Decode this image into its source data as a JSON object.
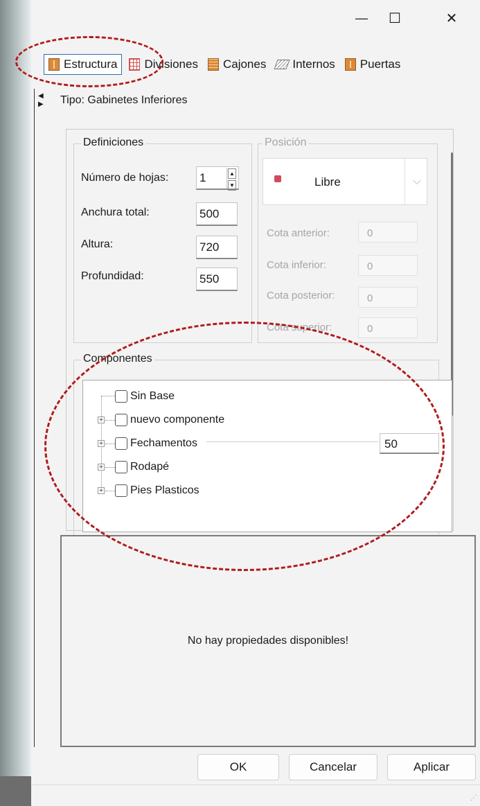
{
  "window": {
    "controls": {
      "minimize": "—",
      "maximize": "☐",
      "close": "✕"
    }
  },
  "tabs": [
    {
      "label": "Estructura",
      "icon": "estructura-icon",
      "active": true
    },
    {
      "label": "Divisiones",
      "icon": "divisiones-grid-icon",
      "active": false
    },
    {
      "label": "Cajones",
      "icon": "cajones-drawer-icon",
      "active": false
    },
    {
      "label": "Internos",
      "icon": "internos-icon",
      "active": false
    },
    {
      "label": "Puertas",
      "icon": "puertas-door-icon",
      "active": false
    }
  ],
  "tipo": "Tipo: Gabinetes Inferiores",
  "definiciones": {
    "legend": "Definiciones",
    "numero_hojas_label": "Número de hojas:",
    "numero_hojas_value": "1",
    "anchura_label": "Anchura total:",
    "anchura_value": "500",
    "altura_label": "Altura:",
    "altura_value": "720",
    "profundidad_label": "Profundidad:",
    "profundidad_value": "550"
  },
  "posicion": {
    "legend": "Posición",
    "combo_value": "Libre",
    "cota_anterior_label": "Cota anterior:",
    "cota_anterior_value": "0",
    "cota_inferior_label": "Cota inferior:",
    "cota_inferior_value": "0",
    "cota_posterior_label": "Cota posterior:",
    "cota_posterior_value": "0",
    "cota_superior_label": "Cota superior:",
    "cota_superior_value": "0"
  },
  "componentes": {
    "legend": "Componentes",
    "items": [
      {
        "label": "Sin Base",
        "expandable": false
      },
      {
        "label": "nuevo componente",
        "expandable": true
      },
      {
        "label": "Fechamentos",
        "expandable": true,
        "value": "50"
      },
      {
        "label": "Rodapé",
        "expandable": true
      },
      {
        "label": "Pies Plasticos",
        "expandable": true
      }
    ]
  },
  "properties_message": "No hay propiedades disponibles!",
  "buttons": {
    "ok": "OK",
    "cancel": "Cancelar",
    "apply": "Aplicar"
  },
  "colors": {
    "annotation": "#b01c1c",
    "active_tab_border": "#2f6fb2"
  }
}
